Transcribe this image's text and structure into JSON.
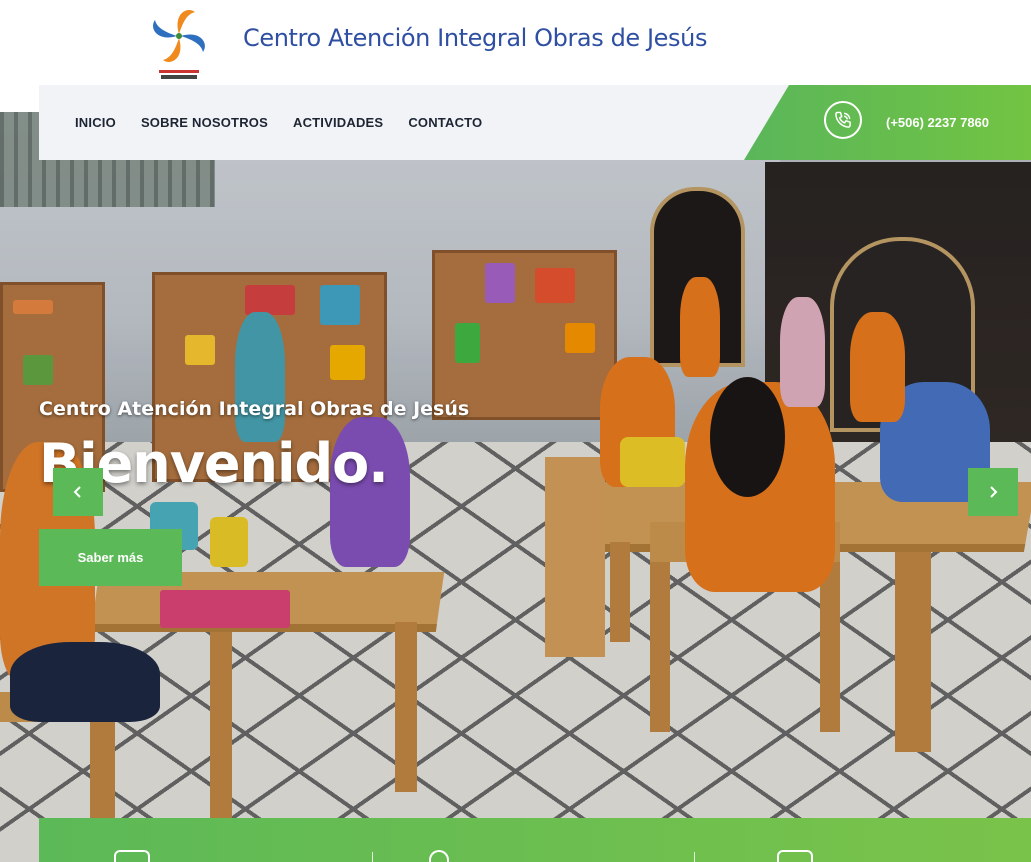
{
  "header": {
    "site_title": "Centro Atención Integral Obras de Jesús",
    "logo_icon": "pinwheel-logo-icon"
  },
  "nav": {
    "items": [
      {
        "label": "INICIO"
      },
      {
        "label": "SOBRE NOSOTROS"
      },
      {
        "label": "ACTIVIDADES"
      },
      {
        "label": "CONTACTO"
      }
    ],
    "phone_icon": "phone-icon",
    "phone": "(+506) 2237 7860"
  },
  "hero": {
    "subtitle": "Centro Atención Integral Obras de Jesús",
    "title": "Bienvenido.",
    "cta_label": "Saber más",
    "prev_icon": "chevron-left-icon",
    "next_icon": "chevron-right-icon"
  },
  "colors": {
    "accent_green": "#5cb957",
    "title_blue": "#2f4fa3",
    "nav_text": "#1d2533",
    "nav_background": "#f2f3f7"
  }
}
